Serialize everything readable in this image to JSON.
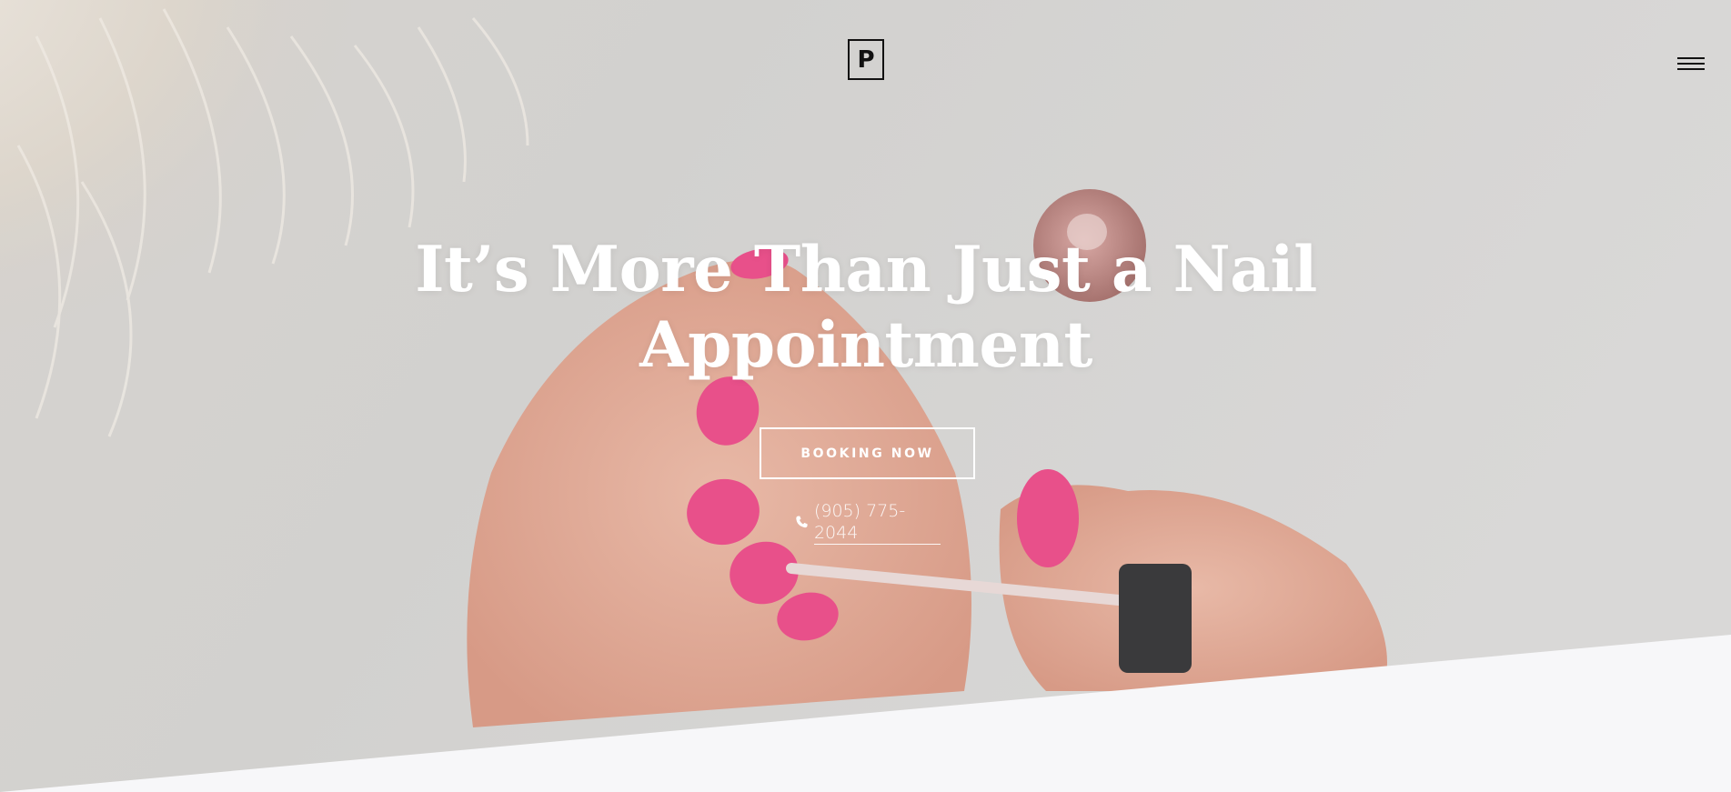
{
  "header": {
    "logo_letter": "P"
  },
  "hero": {
    "headline_line1": "It’s More Than Just a Nail",
    "headline_line2": "Appointment",
    "cta_label": "BOOKING NOW",
    "phone": "(905) 775-2044"
  },
  "icons": {
    "menu": "hamburger-icon",
    "phone": "phone-icon"
  },
  "colors": {
    "text_on_image": "#ffffff",
    "logo": "#111111",
    "nail_pink": "#e8508a",
    "section_bg": "#f7f7f9"
  }
}
